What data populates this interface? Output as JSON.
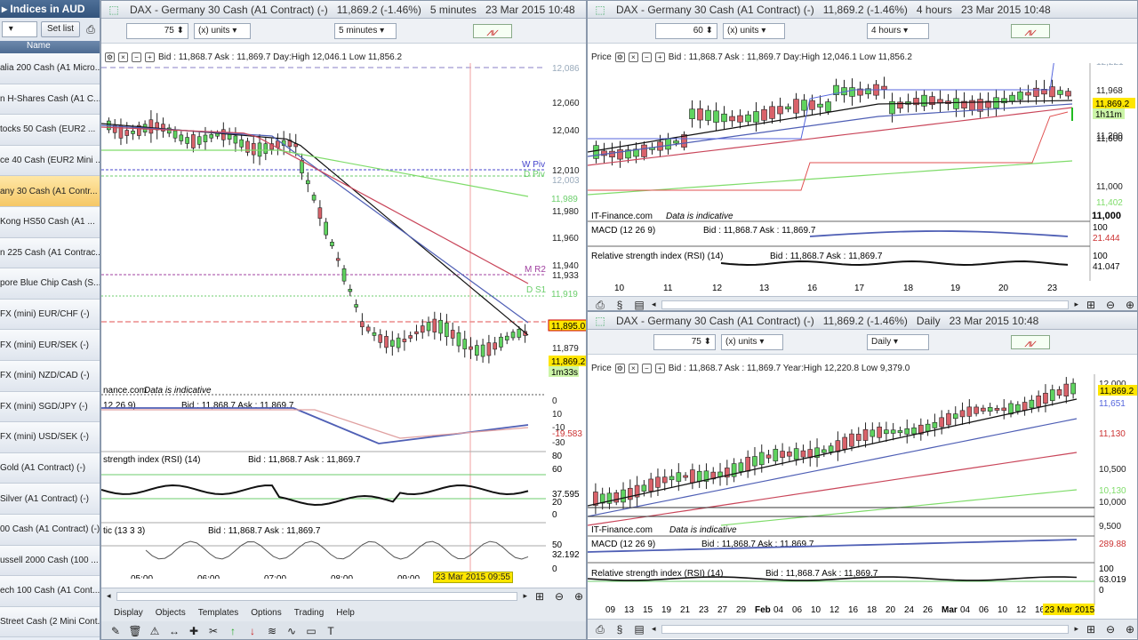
{
  "watchlist": {
    "title": "Indices in AUD",
    "set_list": "Set list",
    "col_name": "Name",
    "items": [
      "alia 200 Cash (A1 Micro...",
      "n H-Shares Cash (A1 C...",
      "tocks 50 Cash (EUR2 ...",
      "ce 40 Cash (EUR2 Mini ...",
      "any 30 Cash (A1 Contr...",
      "Kong HS50 Cash (A1 ...",
      "n 225 Cash (A1 Contrac...",
      "pore Blue Chip Cash (S...",
      "FX (mini) EUR/CHF (-)",
      "FX (mini) EUR/SEK (-)",
      "FX (mini) NZD/CAD (-)",
      "FX (mini) SGD/JPY (-)",
      "FX (mini) USD/SEK (-)",
      "Gold (A1 Contract) (-)",
      "Silver (A1 Contract) (-)",
      "00 Cash (A1 Contract) (-)",
      "ussell 2000 Cash (100 ...",
      "ech 100 Cash (A1 Cont...",
      "Street Cash (2 Mini Cont..."
    ]
  },
  "menu": [
    "Display",
    "Objects",
    "Templates",
    "Options",
    "Trading",
    "Help"
  ],
  "win1": {
    "title": "DAX - Germany 30 Cash (A1 Contract) (-)",
    "price": "11,869.2 (-1.46%)",
    "period": "5 minutes",
    "datetime": "23 Mar 2015 10:48",
    "units_value": "75",
    "units_label": "(x) units",
    "period_select": "5 minutes",
    "price_strip": "Bid : 11,868.7  Ask : 11,869.7  Day:High 12,046.1  Low 11,856.2",
    "yticks": [
      "12,086",
      "12,060",
      "12,040",
      "12,010",
      "12,003",
      "11,980",
      "11,960",
      "11,940",
      "11,933",
      "11,879",
      "11,895.0",
      "11,869.2",
      "1m33s",
      "11,989",
      "11,919"
    ],
    "levels": [
      "W Piv",
      "D Piv",
      "M R2",
      "D S1"
    ],
    "watermark": "nance.com",
    "indicative": "Data is indicative",
    "macd_label": "12 26 9)",
    "macd_strip": "Bid : 11,868.7  Ask : 11,869.7",
    "macd_ticks": [
      "0",
      "10",
      "-10",
      "-19.583",
      "-30"
    ],
    "rsi_label": "strength index (RSI) (14)",
    "rsi_strip": "Bid : 11,868.7  Ask : 11,869.7",
    "rsi_ticks": [
      "80",
      "60",
      "37.595",
      "20",
      "0"
    ],
    "stoch_label": "tic (13 3 3)",
    "stoch_strip": "Bid : 11,868.7  Ask : 11,869.7",
    "stoch_ticks": [
      "50",
      "32.192",
      "0"
    ],
    "xticks": [
      "05:00",
      "06:00",
      "07:00",
      "08:00",
      "09:00"
    ],
    "cursor_date": "23 Mar 2015 09:55"
  },
  "win2": {
    "title": "DAX - Germany 30 Cash (A1 Contract) (-)",
    "price": "11,869.2 (-1.46%)",
    "period": "4 hours",
    "datetime": "23 Mar 2015 10:48",
    "units_value": "60",
    "units_label": "(x) units",
    "period_select": "4 hours",
    "price_label": "Price",
    "price_strip": "Bid : 11,868.7  Ask : 11,869.7  Day:High 12,046.1  Low 11,856.2",
    "yticks": [
      "12,221",
      "11,968",
      "11,869.2",
      "1h11m",
      "11,600",
      "11,402",
      "11,200",
      "11,000"
    ],
    "watermark": "IT-Finance.com",
    "indicative": "Data is indicative",
    "macd_label": "MACD (12 26 9)",
    "macd_strip": "Bid : 11,868.7  Ask : 11,869.7",
    "macd_ticks": [
      "100",
      "21.444"
    ],
    "rsi_label": "Relative strength index (RSI) (14)",
    "rsi_strip": "Bid : 11,868.7  Ask : 11,869.7",
    "rsi_ticks": [
      "100",
      "41.047"
    ],
    "xticks": [
      "10",
      "11",
      "12",
      "13",
      "16",
      "17",
      "18",
      "19",
      "20",
      "23"
    ]
  },
  "win3": {
    "title": "DAX - Germany 30 Cash (A1 Contract) (-)",
    "price": "11,869.2 (-1.46%)",
    "period": "Daily",
    "datetime": "23 Mar 2015 10:48",
    "units_value": "75",
    "units_label": "(x) units",
    "period_select": "Daily",
    "price_label": "Price",
    "price_strip": "Bid : 11,868.7  Ask : 11,869.7  Year:High 12,220.8  Low 9,379.0",
    "yticks": [
      "12,000",
      "11,869.2",
      "11,651",
      "11,130",
      "10,500",
      "10,130",
      "10,000",
      "9,500"
    ],
    "watermark": "IT-Finance.com",
    "indicative": "Data is indicative",
    "macd_label": "MACD (12 26 9)",
    "macd_strip": "Bid : 11,868.7  Ask : 11,869.7",
    "macd_ticks": [
      "289.88"
    ],
    "rsi_label": "Relative strength index (RSI) (14)",
    "rsi_strip": "Bid : 11,868.7  Ask : 11,869.7",
    "rsi_ticks": [
      "100",
      "63.019",
      "0"
    ],
    "xticks": [
      "09",
      "13",
      "15",
      "19",
      "21",
      "23",
      "27",
      "29",
      "Feb",
      "04",
      "06",
      "10",
      "12",
      "16",
      "18",
      "20",
      "24",
      "26",
      "Mar",
      "04",
      "06",
      "10",
      "12",
      "16"
    ],
    "last_date": "23 Mar 2015"
  },
  "colors": {
    "up": "#5fd35f",
    "down": "#d9626a",
    "ma_black": "#111111",
    "ma_blue": "#4f5fb5",
    "ma_red": "#c9465a",
    "ma_green": "#7fdc6a",
    "highlight": "#ffe600"
  }
}
